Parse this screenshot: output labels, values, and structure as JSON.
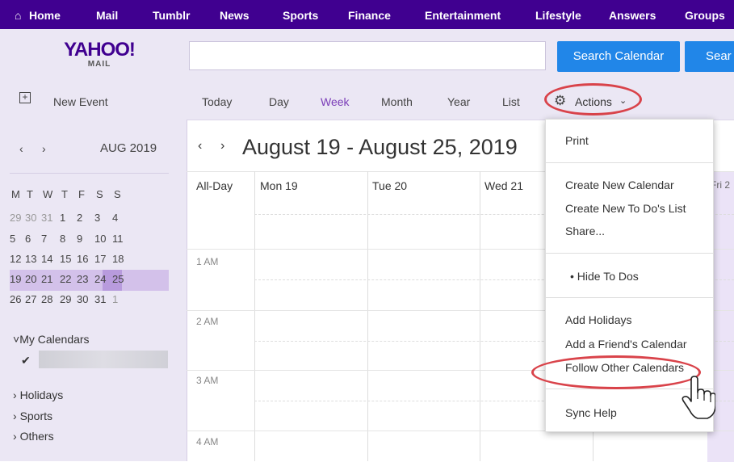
{
  "topnav": {
    "items": [
      "Home",
      "Mail",
      "Tumblr",
      "News",
      "Sports",
      "Finance",
      "Entertainment",
      "Lifestyle",
      "Answers",
      "Groups"
    ]
  },
  "header": {
    "logo_main": "YAHOO!",
    "logo_sub": "MAIL",
    "search_value": "",
    "search_button": "Search Calendar",
    "search_button2": "Sear"
  },
  "toolbar": {
    "new_event": "New Event",
    "views": [
      "Today",
      "Day",
      "Week",
      "Month",
      "Year",
      "List"
    ],
    "actions": "Actions"
  },
  "minical": {
    "month_label": "AUG 2019",
    "weekdays": [
      "M",
      "T",
      "W",
      "T",
      "F",
      "S",
      "S"
    ],
    "weeks": [
      [
        "29",
        "30",
        "31",
        "1",
        "2",
        "3",
        "4"
      ],
      [
        "5",
        "6",
        "7",
        "8",
        "9",
        "10",
        "11"
      ],
      [
        "12",
        "13",
        "14",
        "15",
        "16",
        "17",
        "18"
      ],
      [
        "19",
        "20",
        "21",
        "22",
        "23",
        "24",
        "25"
      ],
      [
        "26",
        "27",
        "28",
        "29",
        "30",
        "31",
        "1"
      ]
    ]
  },
  "calendars": {
    "my_calendars": "My Calendars",
    "holidays": "Holidays",
    "sports": "Sports",
    "others": "Others"
  },
  "main": {
    "title": "August 19 - August 25, 2019",
    "columns": [
      "All-Day",
      "Mon 19",
      "Tue 20",
      "Wed 21",
      "Fri 2"
    ],
    "times": [
      "1 AM",
      "2 AM",
      "3 AM",
      "4 AM"
    ]
  },
  "dropdown": {
    "print": "Print",
    "create_calendar": "Create New Calendar",
    "create_todo": "Create New To Do's List",
    "share": "Share...",
    "hide_todos": "Hide To Dos",
    "add_holidays": "Add Holidays",
    "add_friend": "Add a Friend's Calendar",
    "follow_other": "Follow Other Calendars",
    "sync_help": "Sync Help"
  },
  "colors": {
    "nav_purple": "#400090",
    "header_bg": "#ebe7f4",
    "accent_blue": "#2186e8",
    "highlight_red": "#d9434a"
  }
}
